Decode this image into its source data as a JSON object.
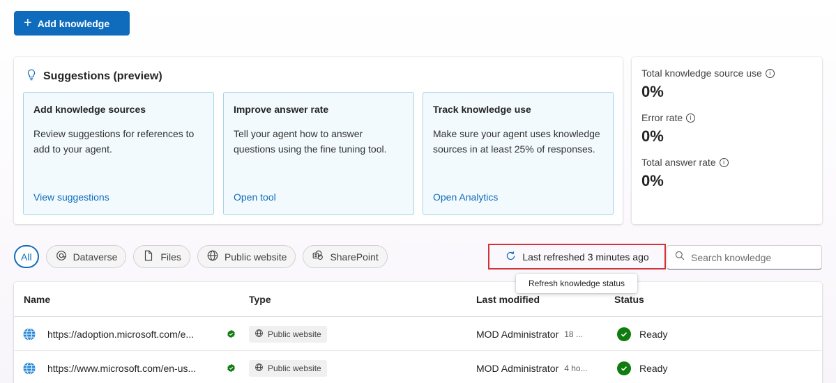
{
  "toolbar": {
    "add_label": "Add knowledge"
  },
  "suggestions": {
    "title": "Suggestions (preview)",
    "tiles": [
      {
        "title": "Add knowledge sources",
        "body": "Review suggestions for references to add to your agent.",
        "link": "View suggestions"
      },
      {
        "title": "Improve answer rate",
        "body": "Tell your agent how to answer questions using the fine tuning tool.",
        "link": "Open tool"
      },
      {
        "title": "Track knowledge use",
        "body": "Make sure your agent uses knowledge sources in at least 25% of responses.",
        "link": "Open Analytics"
      }
    ]
  },
  "metrics": [
    {
      "label": "Total knowledge source use",
      "value": "0%"
    },
    {
      "label": "Error rate",
      "value": "0%"
    },
    {
      "label": "Total answer rate",
      "value": "0%"
    }
  ],
  "filters": [
    "All",
    "Dataverse",
    "Files",
    "Public website",
    "SharePoint"
  ],
  "refresh": {
    "label": "Last refreshed 3 minutes ago",
    "tooltip": "Refresh knowledge status"
  },
  "search": {
    "placeholder": "Search knowledge"
  },
  "table": {
    "headers": [
      "Name",
      "Type",
      "Last modified",
      "Status"
    ],
    "rows": [
      {
        "name": "https://adoption.microsoft.com/e...",
        "type": "Public website",
        "modified_by": "MOD Administrator",
        "modified_time": "18 ...",
        "status": "Ready"
      },
      {
        "name": "https://www.microsoft.com/en-us...",
        "type": "Public website",
        "modified_by": "MOD Administrator",
        "modified_time": "4 ho...",
        "status": "Ready"
      }
    ]
  },
  "colors": {
    "accent": "#0f6cbd",
    "highlight": "#d13438",
    "ready": "#107c10"
  }
}
